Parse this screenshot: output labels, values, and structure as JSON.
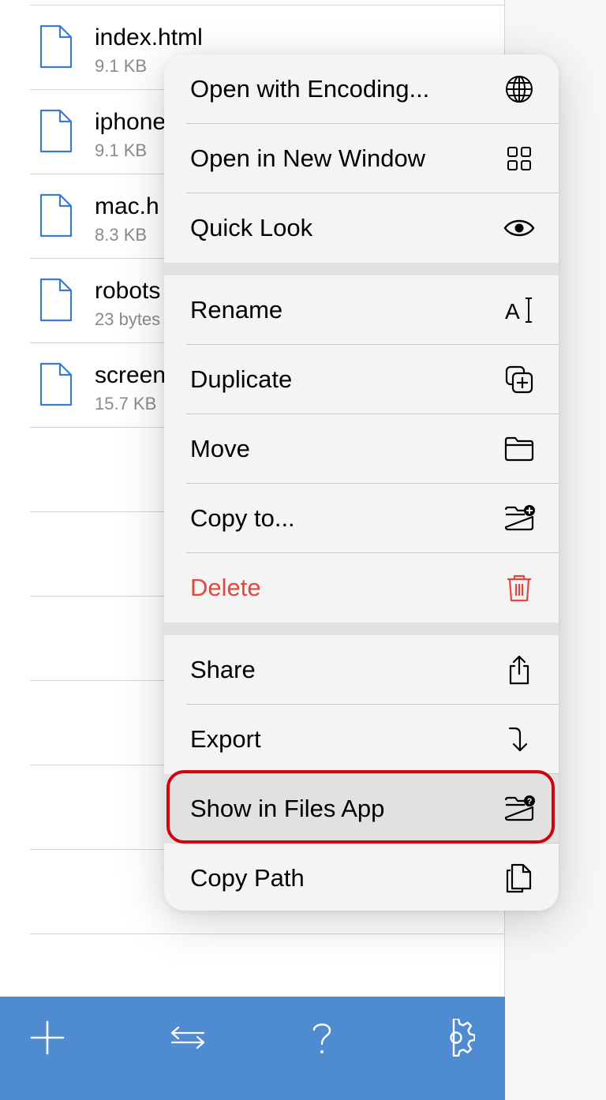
{
  "files": [
    {
      "name": "index.html",
      "size": "9.1 KB"
    },
    {
      "name": "iphone",
      "size": "9.1 KB"
    },
    {
      "name": "mac.h",
      "size": "8.3 KB"
    },
    {
      "name": "robots",
      "size": "23 bytes"
    },
    {
      "name": "screen",
      "size": "15.7 KB"
    }
  ],
  "menu": {
    "items": [
      {
        "label": "Open with Encoding...",
        "icon": "globe-icon"
      },
      {
        "label": "Open in New Window",
        "icon": "grid-icon"
      },
      {
        "label": "Quick Look",
        "icon": "eye-icon"
      },
      {
        "label": "Rename",
        "icon": "rename-text-cursor-icon"
      },
      {
        "label": "Duplicate",
        "icon": "duplicate-plus-icon"
      },
      {
        "label": "Move",
        "icon": "folder-icon"
      },
      {
        "label": "Copy to...",
        "icon": "folder-plus-icon"
      },
      {
        "label": "Delete",
        "icon": "trash-icon",
        "destructive": true
      },
      {
        "label": "Share",
        "icon": "share-icon"
      },
      {
        "label": "Export",
        "icon": "arrow-turn-down-icon"
      },
      {
        "label": "Show in Files App",
        "icon": "folder-question-icon",
        "highlighted": true
      },
      {
        "label": "Copy Path",
        "icon": "copy-documents-icon"
      }
    ]
  },
  "toolbar": {
    "buttons": [
      "plus-icon",
      "swap-arrows-icon",
      "help-icon",
      "gear-icon"
    ]
  },
  "colors": {
    "accent": "#4f8bd0",
    "destructive": "#e5463d",
    "highlight_ring": "#d0000f",
    "file_icon": "#3b7ad0"
  }
}
